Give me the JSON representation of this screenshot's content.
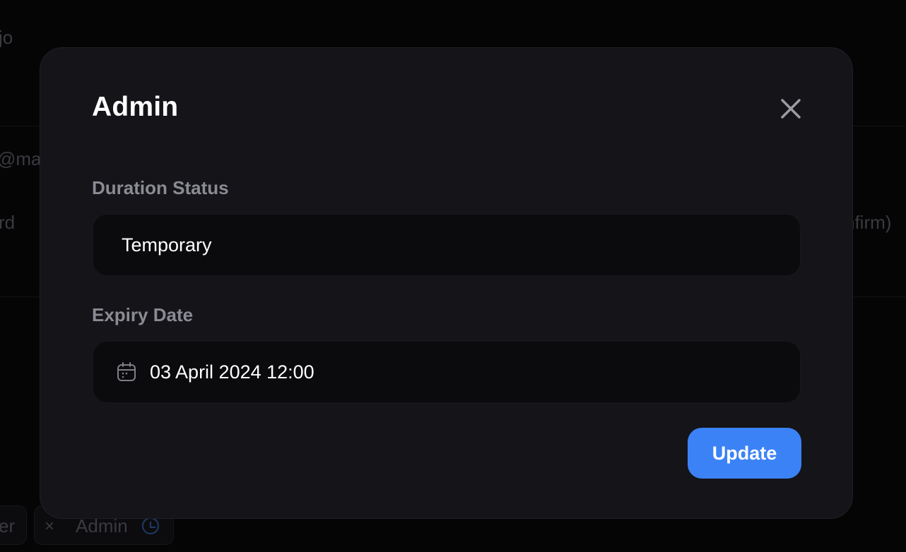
{
  "background": {
    "fragment_top_left": "jo",
    "fragment_email": "@ma",
    "fragment_password": "rd",
    "fragment_confirm": "nfirm)",
    "chip_left_text": "er",
    "chip_remove_symbol": "×",
    "chip_role_text": "Admin",
    "chip_icon": "clock-icon"
  },
  "modal": {
    "title": "Admin",
    "close_icon": "close-icon",
    "duration_label": "Duration Status",
    "duration_value": "Temporary",
    "expiry_label": "Expiry Date",
    "expiry_icon": "calendar-icon",
    "expiry_value": "03 April 2024 12:00",
    "update_label": "Update"
  },
  "colors": {
    "accent": "#3b82f6",
    "modal_bg": "#141419",
    "field_bg": "#0b0b0d",
    "label": "#8b8b93",
    "close_icon": "#9b9ba3"
  }
}
